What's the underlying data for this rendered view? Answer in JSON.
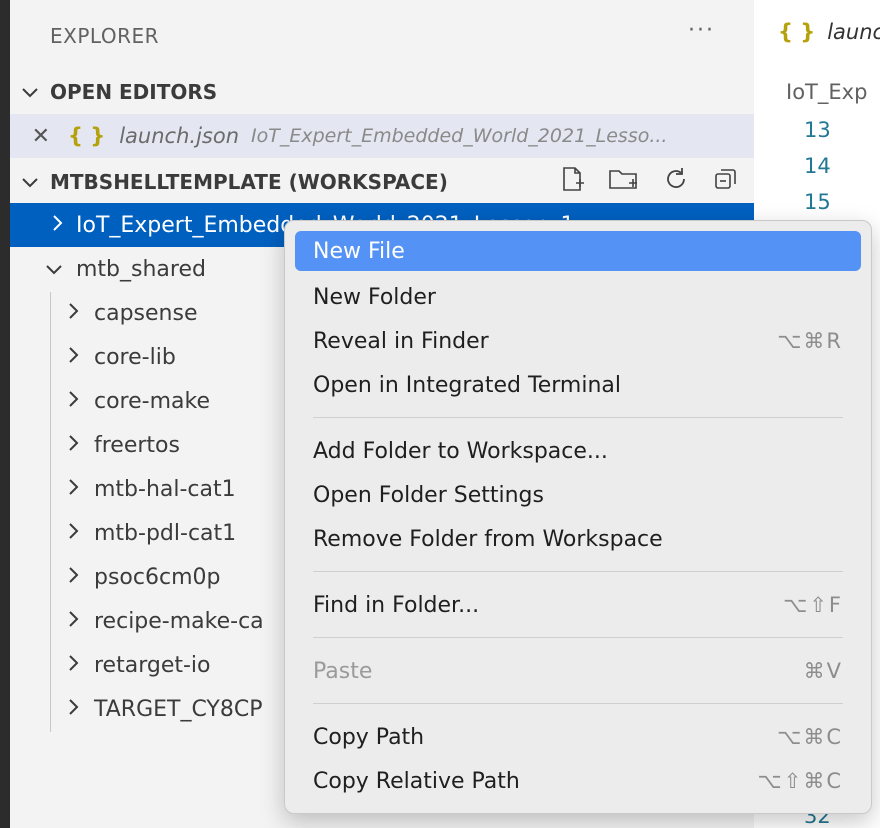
{
  "sidebar": {
    "title": "EXPLORER",
    "more_label": "···",
    "open_editors": {
      "header": "OPEN EDITORS",
      "item": {
        "close_glyph": "✕",
        "braces": "{ }",
        "name": "launch.json",
        "path": "IoT_Expert_Embedded_World_2021_Lesso..."
      }
    },
    "workspace": {
      "header": "MTBSHELLTEMPLATE (WORKSPACE)",
      "actions": [
        "new-file-icon",
        "new-folder-icon",
        "refresh-icon",
        "collapse-all-icon"
      ],
      "selected_folder": "IoT_Expert_Embedded_World_2021_Lesson_1",
      "shared_folder": "mtb_shared",
      "children": [
        "capsense",
        "core-lib",
        "core-make",
        "freertos",
        "mtb-hal-cat1",
        "mtb-pdl-cat1",
        "psoc6cm0p",
        "recipe-make-ca",
        "retarget-io",
        "TARGET_CY8CP"
      ]
    }
  },
  "editor": {
    "tab_braces": "{ }",
    "tab_name": "launc",
    "breadcrumb": "IoT_Exp",
    "line_numbers": [
      "13",
      "14",
      "15",
      "32"
    ]
  },
  "context_menu": {
    "items": [
      {
        "label": "New File",
        "shortcut": ""
      },
      {
        "label": "New Folder",
        "shortcut": ""
      },
      {
        "label": "Reveal in Finder",
        "shortcut": "⌥⌘R"
      },
      {
        "label": "Open in Integrated Terminal",
        "shortcut": ""
      },
      {
        "label": "Add Folder to Workspace...",
        "shortcut": ""
      },
      {
        "label": "Open Folder Settings",
        "shortcut": ""
      },
      {
        "label": "Remove Folder from Workspace",
        "shortcut": ""
      },
      {
        "label": "Find in Folder...",
        "shortcut": "⌥⇧F"
      },
      {
        "label": "Paste",
        "shortcut": "⌘V"
      },
      {
        "label": "Copy Path",
        "shortcut": "⌥⌘C"
      },
      {
        "label": "Copy Relative Path",
        "shortcut": "⌥⇧⌘C"
      }
    ]
  }
}
